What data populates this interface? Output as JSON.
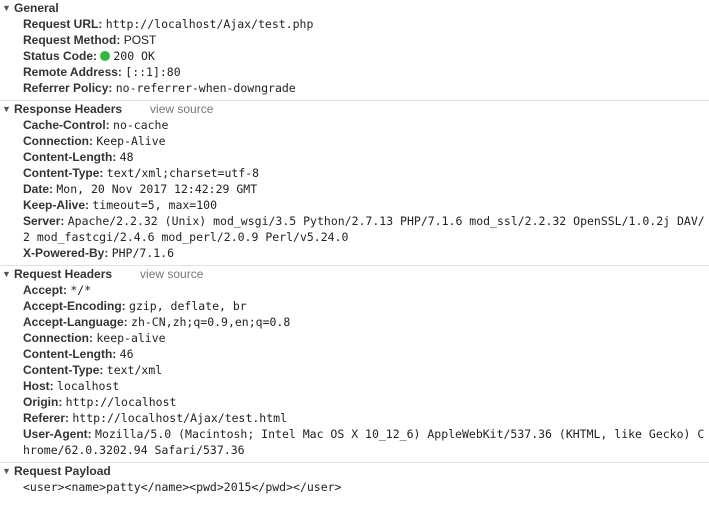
{
  "general": {
    "title": "General",
    "rows": [
      {
        "key": "Request URL:",
        "value": "http://localhost/Ajax/test.php"
      },
      {
        "key": "Request Method:",
        "value": "POST"
      },
      {
        "key": "Status Code:",
        "value": "200 OK",
        "status_color": "#31b93e"
      },
      {
        "key": "Remote Address:",
        "value": "[::1]:80"
      },
      {
        "key": "Referrer Policy:",
        "value": "no-referrer-when-downgrade"
      }
    ]
  },
  "response_headers": {
    "title": "Response Headers",
    "view_source": "view source",
    "rows": [
      {
        "key": "Cache-Control:",
        "value": "no-cache"
      },
      {
        "key": "Connection:",
        "value": "Keep-Alive"
      },
      {
        "key": "Content-Length:",
        "value": "48"
      },
      {
        "key": "Content-Type:",
        "value": "text/xml;charset=utf-8"
      },
      {
        "key": "Date:",
        "value": "Mon, 20 Nov 2017 12:42:29 GMT"
      },
      {
        "key": "Keep-Alive:",
        "value": "timeout=5, max=100"
      },
      {
        "key": "Server:",
        "value": "Apache/2.2.32 (Unix) mod_wsgi/3.5 Python/2.7.13 PHP/7.1.6 mod_ssl/2.2.32 OpenSSL/1.0.2j DAV/2 mod_fastcgi/2.4.6 mod_perl/2.0.9 Perl/v5.24.0"
      },
      {
        "key": "X-Powered-By:",
        "value": "PHP/7.1.6"
      }
    ]
  },
  "request_headers": {
    "title": "Request Headers",
    "view_source": "view source",
    "rows": [
      {
        "key": "Accept:",
        "value": "*/*"
      },
      {
        "key": "Accept-Encoding:",
        "value": "gzip, deflate, br"
      },
      {
        "key": "Accept-Language:",
        "value": "zh-CN,zh;q=0.9,en;q=0.8"
      },
      {
        "key": "Connection:",
        "value": "keep-alive"
      },
      {
        "key": "Content-Length:",
        "value": "46"
      },
      {
        "key": "Content-Type:",
        "value": "text/xml"
      },
      {
        "key": "Host:",
        "value": "localhost"
      },
      {
        "key": "Origin:",
        "value": "http://localhost"
      },
      {
        "key": "Referer:",
        "value": "http://localhost/Ajax/test.html"
      },
      {
        "key": "User-Agent:",
        "value": "Mozilla/5.0 (Macintosh; Intel Mac OS X 10_12_6) AppleWebKit/537.36 (KHTML, like Gecko) Chrome/62.0.3202.94 Safari/537.36"
      }
    ]
  },
  "request_payload": {
    "title": "Request Payload",
    "body": "<user><name>patty</name><pwd>2015</pwd></user>"
  },
  "icons": {
    "expanded": "triangle-down-icon"
  }
}
